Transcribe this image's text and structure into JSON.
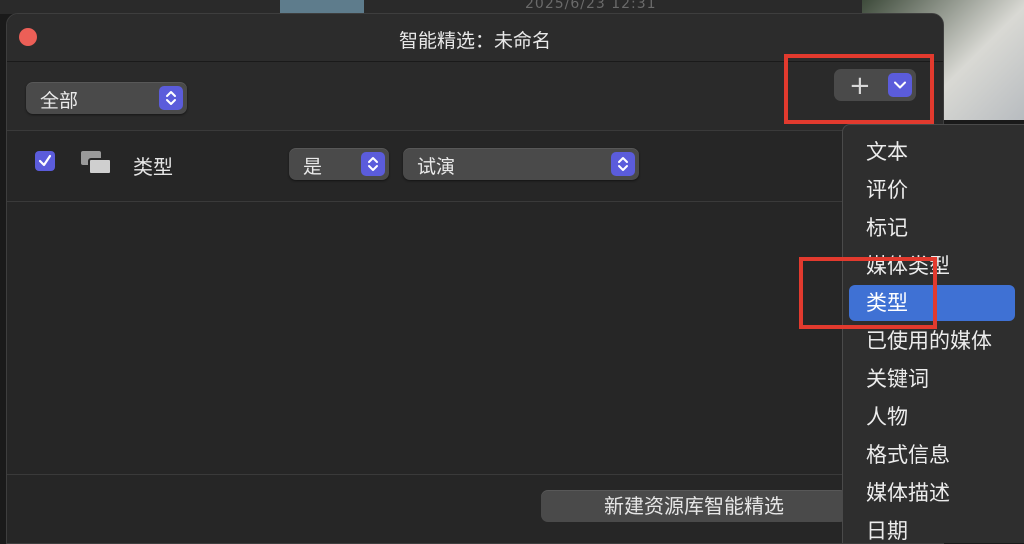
{
  "background": {
    "timestamp": "2025/6/23 12:31"
  },
  "dialog": {
    "title": "智能精选：未命名",
    "match_popup": {
      "value": "全部"
    },
    "add_button": {
      "label": "+"
    },
    "rule": {
      "checked": true,
      "label": "类型",
      "operator": "是",
      "value": "试演"
    },
    "new_button": {
      "label": "新建资源库智能精选"
    }
  },
  "menu": {
    "items": [
      {
        "label": "文本"
      },
      {
        "label": "评价"
      },
      {
        "label": "标记"
      },
      {
        "label": "媒体类型"
      },
      {
        "label": "类型"
      },
      {
        "label": "已使用的媒体"
      },
      {
        "label": "关键词"
      },
      {
        "label": "人物"
      },
      {
        "label": "格式信息"
      },
      {
        "label": "媒体描述"
      },
      {
        "label": "日期"
      }
    ],
    "selected_index": 4
  },
  "colors": {
    "accent": "#5b5cdb",
    "selection": "#3f71d4",
    "highlight": "#e23a2e",
    "close": "#ec5f57"
  }
}
